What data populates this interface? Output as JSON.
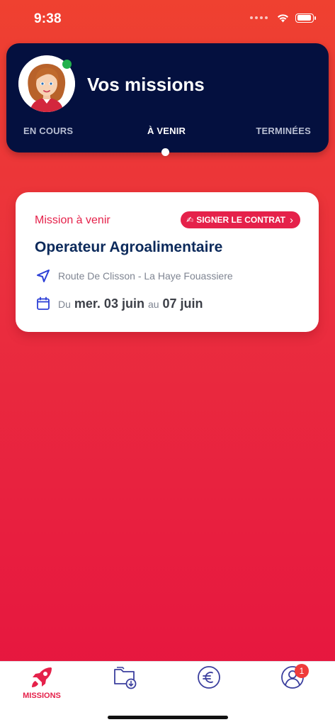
{
  "status_bar": {
    "time": "9:38"
  },
  "header": {
    "title": "Vos missions",
    "tabs": [
      {
        "label": "EN COURS",
        "active": false
      },
      {
        "label": "À VENIR",
        "active": true
      },
      {
        "label": "TERMINÉES",
        "active": false
      }
    ]
  },
  "mission": {
    "status": "Mission à venir",
    "sign_label": "SIGNER LE CONTRAT",
    "title": "Operateur Agroalimentaire",
    "location": "Route De Clisson - La Haye Fouassiere",
    "date_prefix": "Du",
    "date_start": "mer. 03 juin",
    "date_mid": "au",
    "date_end": "07 juin"
  },
  "tab_bar": {
    "missions_label": "MISSIONS",
    "profile_badge": "1"
  },
  "colors": {
    "accent": "#e5214a",
    "header_bg": "#04103f",
    "online": "#23b14d",
    "title": "#0c2a5b"
  }
}
